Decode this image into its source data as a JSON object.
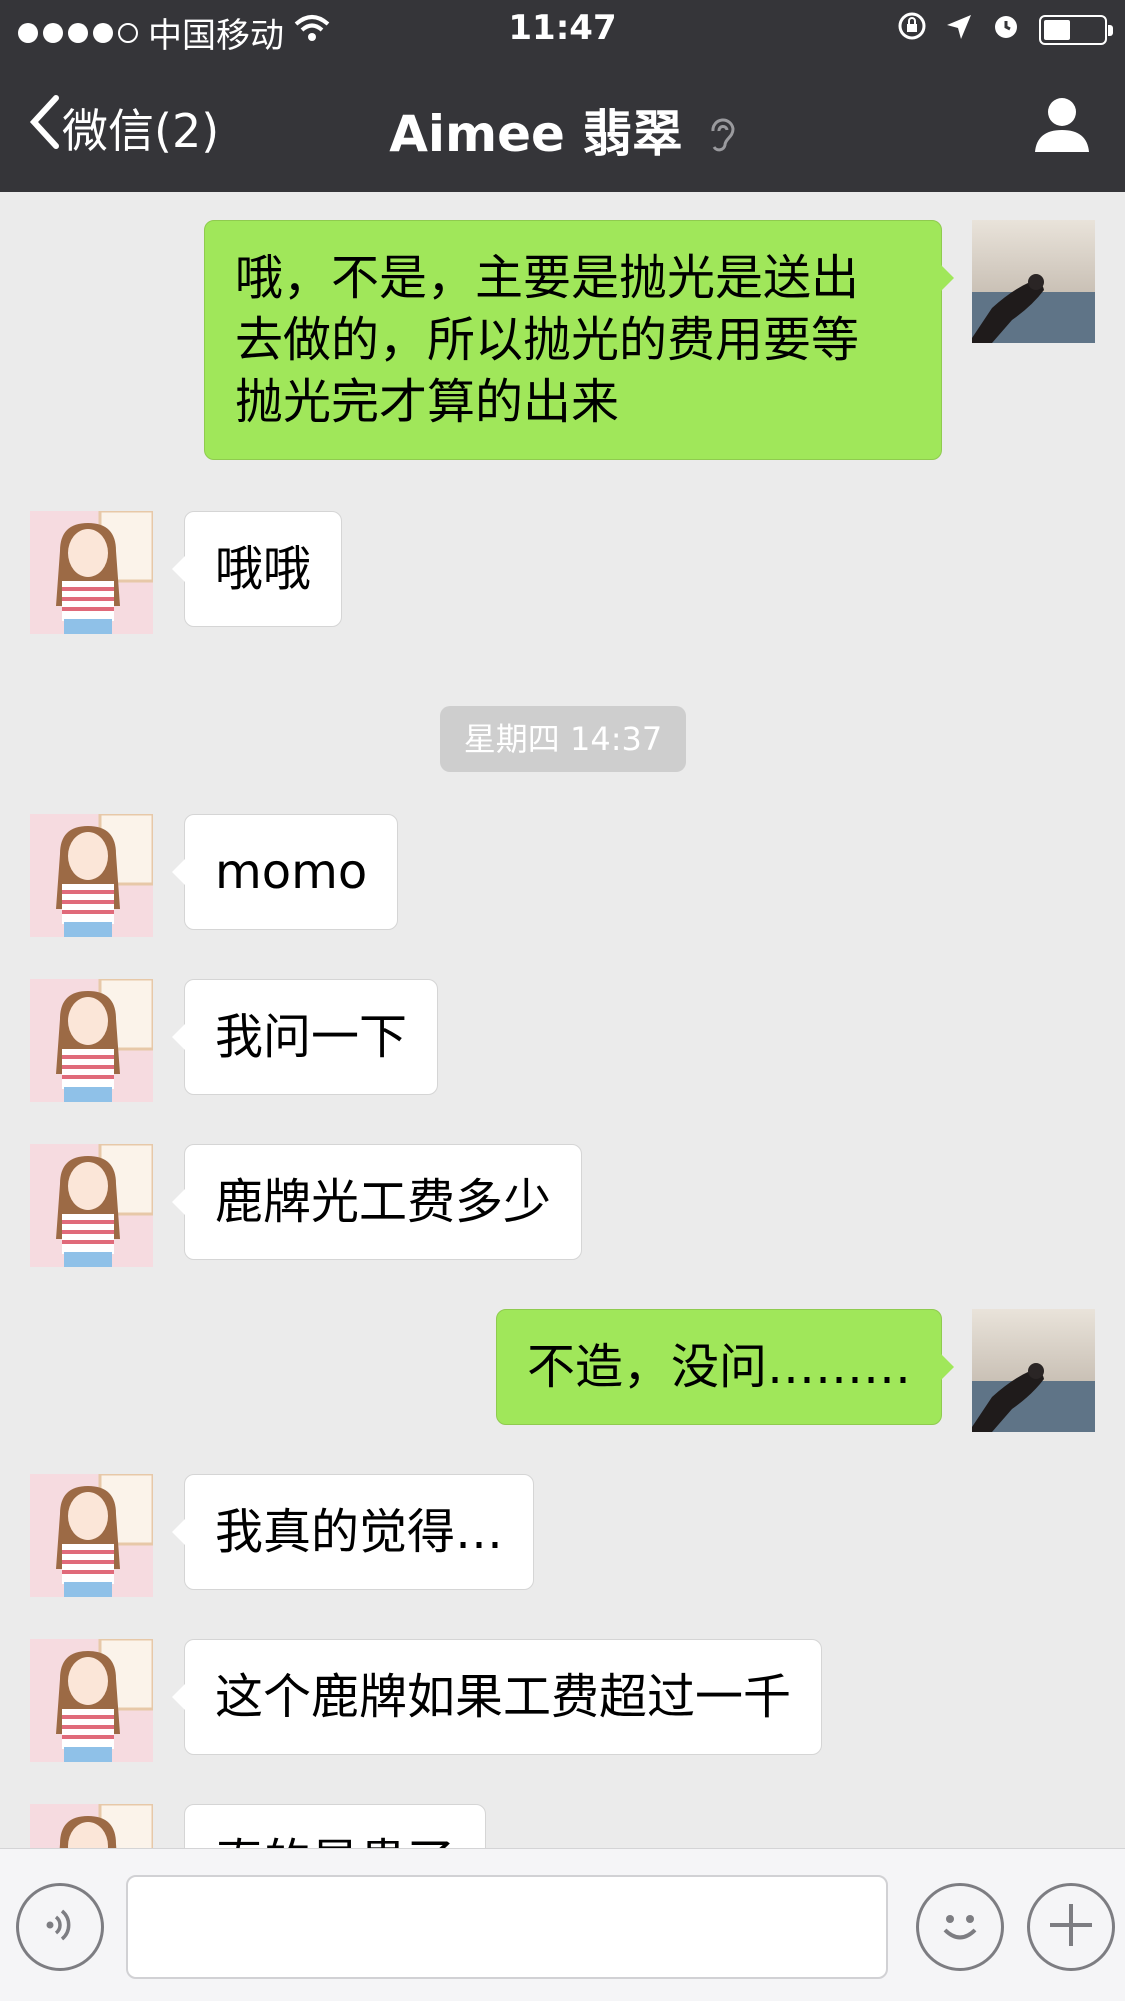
{
  "status_bar": {
    "carrier": "中国移动",
    "time": "11:47",
    "signal_bars": 4,
    "signal_total": 5,
    "battery_level": 0.45
  },
  "nav": {
    "back_label": "微信(2)",
    "title": "Aimee 翡翠"
  },
  "messages": [
    {
      "side": "out",
      "text": "哦，不是，主要是抛光是送出\n去做的，所以抛光的费用要等\n抛光完才算的出来"
    },
    {
      "side": "in",
      "text": "哦哦"
    },
    {
      "timestamp": "星期四 14:37"
    },
    {
      "side": "in",
      "text": "momo"
    },
    {
      "side": "in",
      "text": "我问一下"
    },
    {
      "side": "in",
      "text": "鹿牌光工费多少"
    },
    {
      "side": "out",
      "text": "不造，没问………"
    },
    {
      "side": "in",
      "text": "我真的觉得…"
    },
    {
      "side": "in",
      "text": "这个鹿牌如果工费超过一千"
    },
    {
      "side": "in",
      "text": "真的是贵了"
    }
  ],
  "toolbar": {
    "input_value": ""
  },
  "colors": {
    "nav_bg": "#353539",
    "chat_bg": "#ebebeb",
    "outgoing_bubble": "#a0e75a",
    "incoming_bubble": "#ffffff"
  },
  "icons": {
    "back": "chevron-left-icon",
    "ear": "ear-icon",
    "contact": "person-icon",
    "voice": "voice-icon",
    "emoji": "emoji-icon",
    "more": "plus-icon"
  }
}
